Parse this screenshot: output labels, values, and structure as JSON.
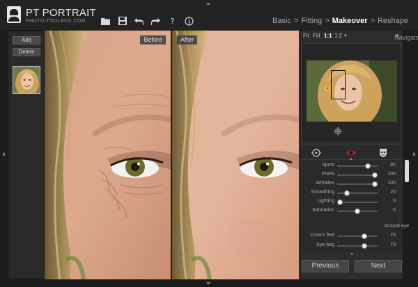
{
  "app": {
    "name": "PT PORTRAIT",
    "url": "PHOTO-TOOLBOX.COM"
  },
  "toolbar": {
    "help_label": "?",
    "info_label": "i"
  },
  "breadcrumb": {
    "items": [
      "Basic",
      ">",
      "Fitting",
      ">",
      "Makeover",
      ">",
      "Reshape"
    ],
    "active": "Makeover"
  },
  "left_panel": {
    "add_label": "Add",
    "delete_label": "Delete"
  },
  "photo": {
    "before_label": "Before",
    "after_label": "After"
  },
  "navigator": {
    "fit": "Fit",
    "fill": "Fill",
    "one_to_one": "1:1",
    "one_to_two": "1:2",
    "title": "Navigator"
  },
  "sliders": [
    {
      "label": "Spots",
      "value": "80",
      "level": 0.8
    },
    {
      "label": "Pores",
      "value": "100",
      "level": 1.0
    },
    {
      "label": "Wrinkles",
      "value": "100",
      "level": 1.0
    },
    {
      "label": "Smoothing",
      "value": "20",
      "level": 0.2
    },
    {
      "label": "Lighting",
      "value": "0",
      "level": 0.0
    },
    {
      "label": "Saturation",
      "value": "0",
      "level": 0.5
    }
  ],
  "around_eye": {
    "title": "Around eye",
    "sliders": [
      {
        "label": "Crow's feet",
        "value": "70",
        "level": 0.7
      },
      {
        "label": "Eye bag",
        "value": "70",
        "level": 0.7
      }
    ]
  },
  "buttons": {
    "previous": "Previous",
    "next": "Next"
  },
  "colors": {
    "background": "#1c1c1c",
    "panel": "#2d2d2d",
    "active_crumb": "#ffffff",
    "eye_icon": "#b3282a"
  }
}
